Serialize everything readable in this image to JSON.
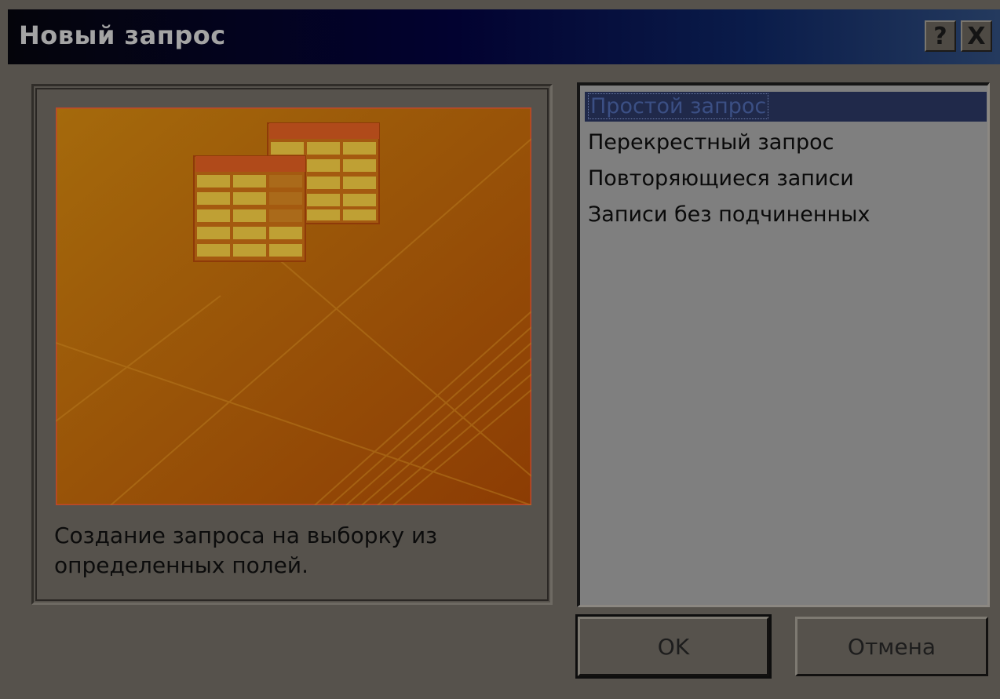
{
  "window": {
    "title": "Новый запрос",
    "help_label": "?",
    "close_label": "X"
  },
  "preview": {
    "description": "Создание запроса на выборку из определенных полей."
  },
  "wizard_list": {
    "items": [
      {
        "label": "Простой запрос",
        "selected": true
      },
      {
        "label": "Перекрестный запрос",
        "selected": false
      },
      {
        "label": "Повторяющиеся записи",
        "selected": false
      },
      {
        "label": "Записи без подчиненных",
        "selected": false
      }
    ]
  },
  "buttons": {
    "ok": "OK",
    "cancel": "Отмена"
  },
  "colors": {
    "preview_gradient_start": "#a56a0c",
    "preview_gradient_end": "#8c3c04",
    "selected_item_bg": "#20294a",
    "dialog_bg": "#56524c"
  }
}
